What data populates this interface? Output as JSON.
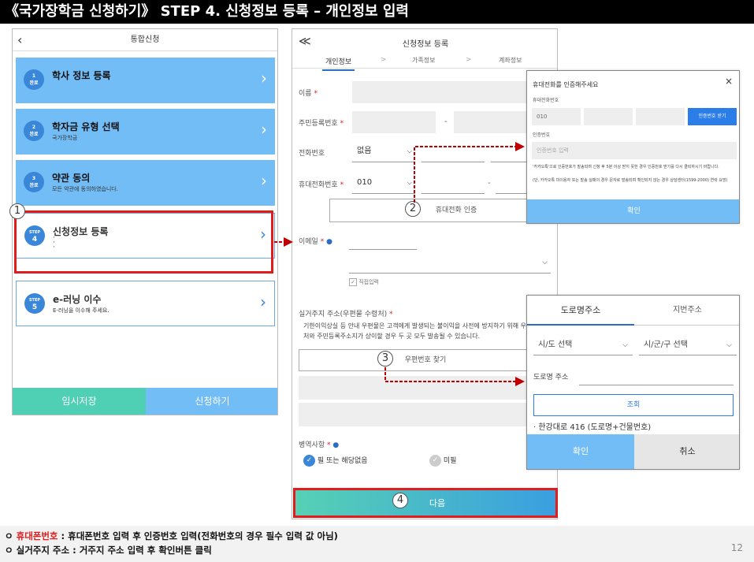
{
  "banner": "《국가장학금 신청하기》 STEP 4. 신청정보 등록 – 개인정보 입력",
  "left_phone": {
    "header": "통합신청",
    "back_icon": "‹",
    "steps": [
      {
        "badge_num": "1",
        "badge_text": "완료",
        "title": "학사 정보 등록",
        "sub": ""
      },
      {
        "badge_num": "2",
        "badge_text": "완료",
        "title": "학자금 유형 선택",
        "sub": "국가장학금"
      },
      {
        "badge_num": "3",
        "badge_text": "완료",
        "title": "약관 동의",
        "sub": "모든 약관에 동의하였습니다."
      },
      {
        "badge_num": "4",
        "badge_text": "STEP",
        "title": "신청정보 등록",
        "sub": "·\n·\n·"
      },
      {
        "badge_num": "5",
        "badge_text": "STEP",
        "title": "e-러닝 이수",
        "sub": "E-러닝을 이수해 주세요."
      }
    ],
    "save_label": "임시저장",
    "apply_label": "신청하기"
  },
  "mid_phone": {
    "back_icon": "≪",
    "header": "신청정보 등록",
    "tabs": [
      "개인정보",
      "가족정보",
      "계좌정보"
    ],
    "tab_sep": ">",
    "name_label": "이름",
    "rrn_label": "주민등록번호",
    "phone_label": "전화번호",
    "phone_value": "없음",
    "mobile_label": "휴대전화번호",
    "mobile_value": "010",
    "verify_btn": "휴대전화 인증",
    "email_label": "이메일",
    "direct_input": "직접입력",
    "address_label": "실거주지 주소(우편물 수령처)",
    "address_note": "기한이익상실 등 안내 우편물은 고객에게 발생되는 불이익을 사전에 방지하기 위해 우편물수령처와 주민등록주소지가 상이할 경우 두 곳 모두 발송될 수 있습니다.",
    "zip_btn": "우편번호 찾기",
    "military_label": "병역사항",
    "military_opt1": "필 또는 해당없음",
    "military_opt2": "미필",
    "next_label": "다음"
  },
  "auth_popup": {
    "title": "휴대전화를 인증해주세요",
    "close_icon": "×",
    "phone_label": "휴대전화번호",
    "phone_prefix": "010",
    "get_code_btn": "인증번호 받기",
    "code_label": "인증번호",
    "code_placeholder": "인증번호 입력",
    "notice1": "'카카오톡'으로 인증번호가 발송되며 신청 후 5분 이상 받지 못한 경우 인증번호 받기를 다시 클릭하시기 바랍니다.",
    "notice2": "(단, 카카오톡 미이용자 또는 발송 실패의 경우 문자로 발송되며 확인되지 않는 경우 상담센터(1599-2000) 연락 요망)",
    "confirm_label": "확인"
  },
  "addr_popup": {
    "tab_road": "도로명주소",
    "tab_lot": "지번주소",
    "sido": "시/도 선택",
    "sigungu": "시/군/구 선택",
    "road_label": "도로명 주소",
    "search_btn": "조회",
    "result": "한강대로 416 (도로명+건물번호)",
    "confirm_label": "확인",
    "cancel_label": "취소"
  },
  "markers": [
    "1",
    "2",
    "3",
    "4"
  ],
  "footer": {
    "line1_bullet": "ㅇ",
    "line1_highlight": "휴대폰번호",
    "line1_text": " : 휴대폰번호 입력 후 인증번호 입력(전화번호의 경우 필수 입력 값 아님)",
    "line2_bullet": "ㅇ",
    "line2_text": "실거주지 주소 : 거주지 주소 입력 후 확인버튼 클릭",
    "page_num": "12"
  }
}
